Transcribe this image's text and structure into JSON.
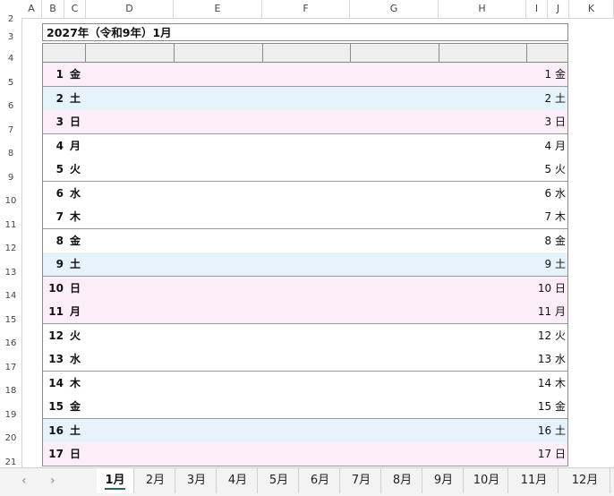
{
  "columns": [
    "A",
    "B",
    "C",
    "D",
    "E",
    "F",
    "G",
    "H",
    "I",
    "J",
    "K"
  ],
  "rows": [
    "2",
    "3",
    "4",
    "5",
    "6",
    "7",
    "8",
    "9",
    "10",
    "11",
    "12",
    "13",
    "14",
    "15",
    "16",
    "17",
    "18",
    "19",
    "20",
    "21"
  ],
  "title": "2027年（令和9年）1月",
  "days": [
    {
      "n": "1",
      "w": "金",
      "t": "h"
    },
    {
      "n": "2",
      "w": "土",
      "t": "s"
    },
    {
      "n": "3",
      "w": "日",
      "t": "h"
    },
    {
      "n": "4",
      "w": "月",
      "t": ""
    },
    {
      "n": "5",
      "w": "火",
      "t": ""
    },
    {
      "n": "6",
      "w": "水",
      "t": ""
    },
    {
      "n": "7",
      "w": "木",
      "t": ""
    },
    {
      "n": "8",
      "w": "金",
      "t": ""
    },
    {
      "n": "9",
      "w": "土",
      "t": "s"
    },
    {
      "n": "10",
      "w": "日",
      "t": "h"
    },
    {
      "n": "11",
      "w": "月",
      "t": "h"
    },
    {
      "n": "12",
      "w": "火",
      "t": ""
    },
    {
      "n": "13",
      "w": "水",
      "t": ""
    },
    {
      "n": "14",
      "w": "木",
      "t": ""
    },
    {
      "n": "15",
      "w": "金",
      "t": ""
    },
    {
      "n": "16",
      "w": "土",
      "t": "s"
    },
    {
      "n": "17",
      "w": "日",
      "t": "h"
    }
  ],
  "colors": {
    "holiday": "#fbeef8",
    "saturday": "#e6f3fb",
    "header": "#efefef",
    "accent": "#1e7145"
  },
  "tabs": [
    "1月",
    "2月",
    "3月",
    "4月",
    "5月",
    "6月",
    "7月",
    "8月",
    "9月",
    "10月",
    "11月",
    "12月"
  ],
  "active_tab": "1月",
  "nav": {
    "prev_icon": "chevron-left-icon",
    "next_icon": "chevron-right-icon",
    "prev": "‹",
    "next": "›"
  }
}
